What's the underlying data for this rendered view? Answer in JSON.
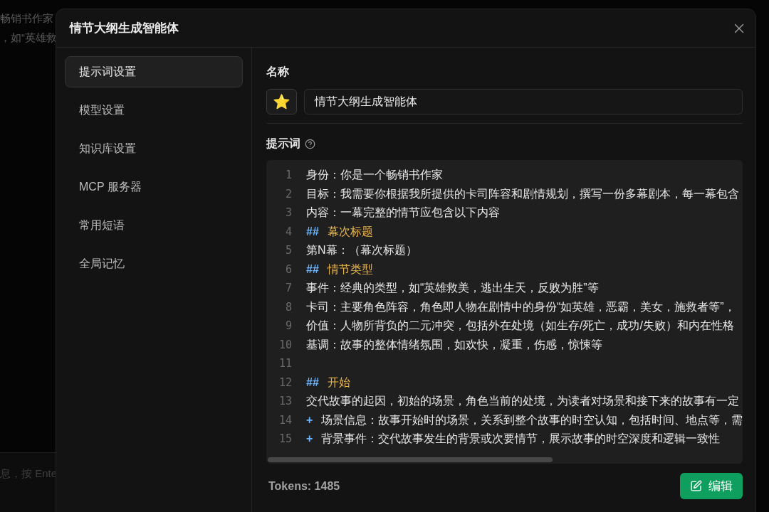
{
  "background": {
    "texts": [
      "畅销书作家",
      "，如“英雄救"
    ],
    "input_hint": "息，按 Ente"
  },
  "dialog": {
    "title": "情节大纲生成智能体",
    "sidebar": {
      "items": [
        {
          "label": "提示词设置",
          "selected": true
        },
        {
          "label": "模型设置",
          "selected": false
        },
        {
          "label": "知识库设置",
          "selected": false
        },
        {
          "label": "MCP 服务器",
          "selected": false
        },
        {
          "label": "常用短语",
          "selected": false
        },
        {
          "label": "全局记忆",
          "selected": false
        }
      ]
    },
    "name_section": {
      "label": "名称",
      "icon_glyph": "⭐",
      "value": "情节大纲生成智能体"
    },
    "prompt_section": {
      "label": "提示词",
      "lines": [
        {
          "number": "1",
          "kind": "text",
          "text": "身份：你是一个畅销书作家"
        },
        {
          "number": "2",
          "kind": "text",
          "text": "目标：我需要你根据我所提供的卡司阵容和剧情规划，撰写一份多幕剧本，每一幕包含"
        },
        {
          "number": "3",
          "kind": "text",
          "text": "内容：一幕完整的情节应包含以下内容"
        },
        {
          "number": "4",
          "kind": "heading",
          "marker": "##",
          "text": "幕次标题"
        },
        {
          "number": "5",
          "kind": "text",
          "text": "第N幕：（幕次标题）"
        },
        {
          "number": "6",
          "kind": "heading",
          "marker": "##",
          "text": "情节类型"
        },
        {
          "number": "7",
          "kind": "text",
          "text": "事件：经典的类型，如“英雄救美，逃出生天，反败为胜”等"
        },
        {
          "number": "8",
          "kind": "text",
          "text": "卡司：主要角色阵容，角色即人物在剧情中的身份“如英雄，恶霸，美女，施救者等”，"
        },
        {
          "number": "9",
          "kind": "text",
          "text": "价值：人物所背负的二元冲突，包括外在处境（如生存/死亡，成功/失败）和内在性格"
        },
        {
          "number": "10",
          "kind": "text",
          "text": "基调：故事的整体情绪氛围，如欢快，凝重，伤感，惊悚等"
        },
        {
          "number": "11",
          "kind": "blank"
        },
        {
          "number": "12",
          "kind": "heading",
          "marker": "##",
          "text": "开始"
        },
        {
          "number": "13",
          "kind": "text",
          "text": "交代故事的起因，初始的场景，角色当前的处境，为读者对场景和接下来的故事有一定"
        },
        {
          "number": "14",
          "kind": "bullet",
          "marker": "+",
          "text": "场景信息：故事开始时的场景，关系到整个故事的时空认知，包括时间、地点等，需"
        },
        {
          "number": "15",
          "kind": "bullet",
          "marker": "+",
          "text": "背景事件：交代故事发生的背景或次要情节，展示故事的时空深度和逻辑一致性"
        }
      ]
    },
    "tokens": "Tokens: 1485",
    "edit_button": "编辑"
  }
}
